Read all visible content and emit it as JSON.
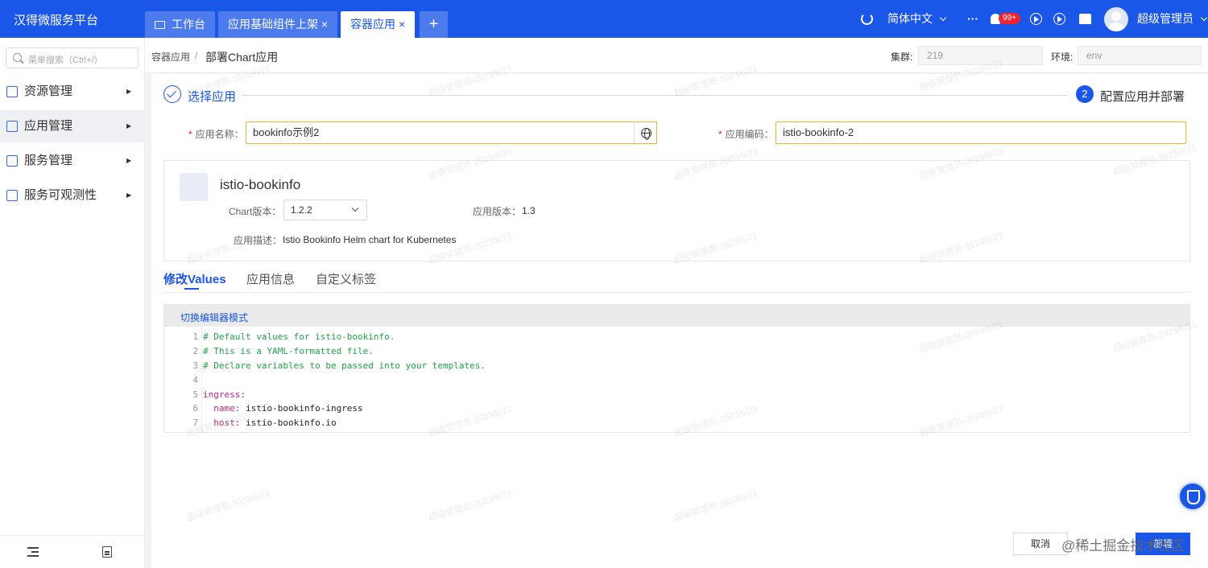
{
  "app": {
    "brand": "汉得微服务平台"
  },
  "tabs": [
    {
      "label": "工作台",
      "icon": "monitor-icon",
      "closable": false,
      "active": false
    },
    {
      "label": "应用基础组件上架",
      "closable": true,
      "active": false
    },
    {
      "label": "容器应用",
      "closable": true,
      "active": true
    }
  ],
  "tab_close_glyph": "×",
  "tab_add_glyph": "+",
  "header": {
    "language": "简体中文",
    "more": "···",
    "notification_count": "99+",
    "user_name": "超级管理员"
  },
  "sidebar": {
    "search_placeholder": "菜单搜索（Ctrl+/）",
    "items": [
      {
        "label": "资源管理",
        "active": false
      },
      {
        "label": "应用管理",
        "active": true
      },
      {
        "label": "服务管理",
        "active": false
      },
      {
        "label": "服务可观测性",
        "active": false
      }
    ]
  },
  "breadcrumb": {
    "parent": "容器应用",
    "separator": "/",
    "current": "部署Chart应用"
  },
  "env": {
    "cluster_label": "集群:",
    "cluster_value": "219",
    "env_label": "环境:",
    "env_value": "env"
  },
  "steps": [
    {
      "label": "选择应用",
      "done": true
    },
    {
      "number": "2",
      "label": "配置应用并部署",
      "current": true
    }
  ],
  "form": {
    "required_mark": "*",
    "app_name_label": "应用名称：",
    "app_name_value": "bookinfo示例2",
    "app_code_label": "应用编码：",
    "app_code_value": "istio-bookinfo-2"
  },
  "chart_info": {
    "name": "istio-bookinfo",
    "chart_version_label": "Chart版本：",
    "chart_version_value": "1.2.2",
    "app_version_label": "应用版本：",
    "app_version_value": "1.3",
    "description_label": "应用描述：",
    "description_value": "Istio Bookinfo Helm chart for Kubernetes"
  },
  "panel_tabs": [
    {
      "label": "修改Values",
      "active": true
    },
    {
      "label": "应用信息",
      "active": false
    },
    {
      "label": "自定义标签",
      "active": false
    }
  ],
  "editor": {
    "switch_label": "切换编辑器模式",
    "lines": [
      {
        "n": "1",
        "text": "# Default values for istio-bookinfo.",
        "kind": "comment"
      },
      {
        "n": "2",
        "text": "# This is a YAML-formatted file.",
        "kind": "comment"
      },
      {
        "n": "3",
        "text": "# Declare variables to be passed into your templates.",
        "kind": "comment"
      },
      {
        "n": "4",
        "text": "",
        "kind": "blank"
      },
      {
        "n": "5",
        "text": "ingress:",
        "kind": "key"
      },
      {
        "n": "6",
        "key": "  name:",
        "value": " istio-bookinfo-ingress",
        "kind": "pair"
      },
      {
        "n": "7",
        "key": "  host:",
        "value": " istio-bookinfo.io",
        "kind": "pair"
      }
    ]
  },
  "actions": {
    "cancel": "取消",
    "deploy": "部署"
  },
  "watermark_text": "超级管理员-2023/6/21",
  "site_watermark": "@稀土掘金技术社区",
  "colors": {
    "primary": "#1a56e8",
    "warning_border": "#f0b429",
    "comment": "#22a34b",
    "yaml_key": "#c0267d"
  }
}
